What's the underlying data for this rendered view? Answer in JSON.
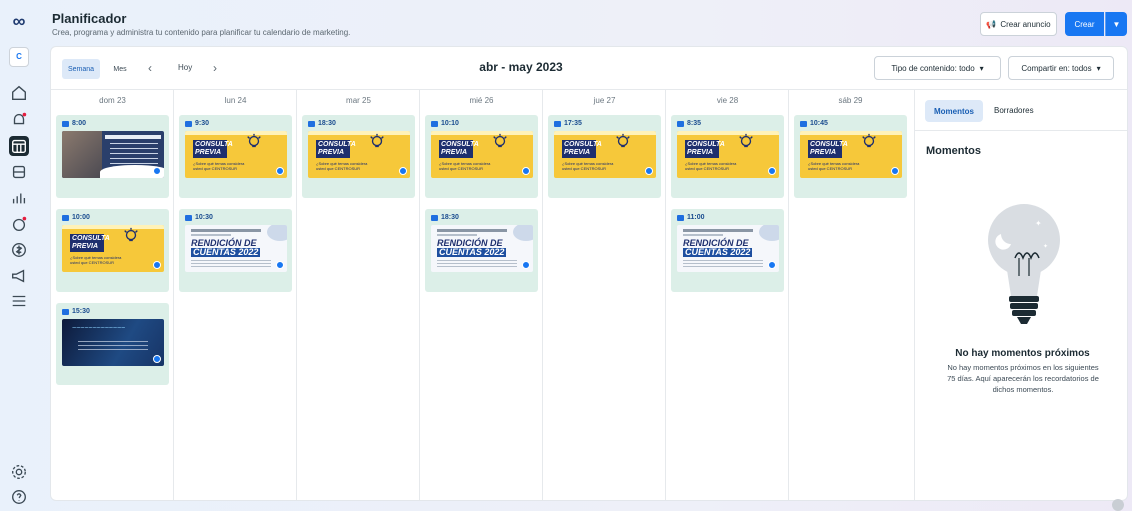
{
  "header": {
    "title": "Planificador",
    "subtitle": "Crea, programa y administra tu contenido para planificar tu calendario de marketing.",
    "ad_button": "Crear anuncio",
    "create_button": "Crear"
  },
  "rail": {
    "avatar_text": "C",
    "icons": [
      "meta-logo-icon",
      "home-icon",
      "notifications-icon",
      "planner-icon",
      "content-icon",
      "insights-icon",
      "ads-icon",
      "monetization-icon",
      "promote-icon",
      "menu-icon",
      "settings-icon",
      "help-icon"
    ]
  },
  "toolbar": {
    "week": "Semana",
    "month": "Mes",
    "today": "Hoy",
    "range": "abr - may 2023",
    "filter_type": "Tipo de contenido: todo",
    "filter_share": "Compartir en: todos"
  },
  "days": [
    "dom 23",
    "lun 24",
    "mar 25",
    "mié 26",
    "jue 27",
    "vie 28",
    "sáb 29"
  ],
  "events": [
    {
      "time": "8:00",
      "thumb": "centro"
    },
    {
      "time": "10:00",
      "thumb": "consulta"
    },
    {
      "time": "15:30",
      "thumb": "dark"
    },
    {
      "time": "9:30",
      "thumb": "consulta"
    },
    {
      "time": "10:30",
      "thumb": "rendicion"
    },
    {
      "time": "18:30",
      "thumb": "consulta"
    },
    {
      "time": "10:10",
      "thumb": "consulta"
    },
    {
      "time": "18:30",
      "thumb": "rendicion"
    },
    {
      "time": "17:35",
      "thumb": "consulta"
    },
    {
      "time": "8:35",
      "thumb": "consulta"
    },
    {
      "time": "11:00",
      "thumb": "rendicion"
    },
    {
      "time": "10:45",
      "thumb": "consulta"
    }
  ],
  "thumbs": {
    "consulta_line1": "CONSULTA",
    "consulta_line2": "PREVIA",
    "consulta_small": "¿Sobre qué temas considera usted que CENTROSUR",
    "rend_line1": "RENDICIÓN DE",
    "rend_line2": "CUENTAS 2022"
  },
  "side": {
    "tab_moments": "Momentos",
    "tab_drafts": "Borradores",
    "title": "Momentos",
    "empty_title": "No hay momentos próximos",
    "empty_text": "No hay momentos próximos en los siguientes 75 días. Aquí aparecerán los recordatorios de dichos momentos."
  },
  "colors": {
    "accent": "#1877f2",
    "event_bg": "#dcefe8",
    "poster_yellow": "#f6c83a"
  }
}
